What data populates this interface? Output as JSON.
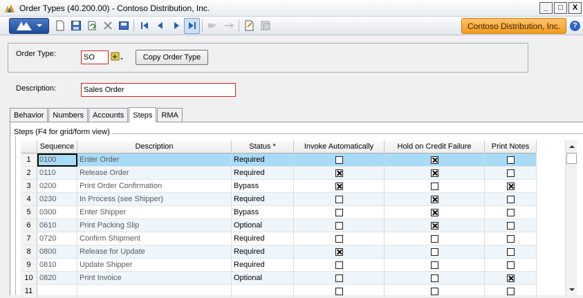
{
  "window": {
    "title": "Order Types (40.200.00) - Contoso Distribution, Inc.",
    "minimize": "_",
    "maximize": "□",
    "close": "X"
  },
  "toolbar": {
    "company": "Contoso Distribution, Inc.",
    "help": "?"
  },
  "form": {
    "order_type_label": "Order Type:",
    "order_type_value": "SO",
    "copy_button": "Copy Order Type",
    "description_label": "Description:",
    "description_value": "Sales Order"
  },
  "tabs": [
    {
      "label": "Behavior"
    },
    {
      "label": "Numbers"
    },
    {
      "label": "Accounts"
    },
    {
      "label": "Steps"
    },
    {
      "label": "RMA"
    }
  ],
  "active_tab": "Steps",
  "steps": {
    "group_label": "Steps (F4 for grid/form view)",
    "columns": [
      "",
      "Sequence",
      "Description",
      "Status *",
      "Invoke Automatically",
      "Hold on Credit Failure",
      "Print Notes"
    ],
    "rows": [
      {
        "num": "1",
        "sequence": "0100",
        "description": "Enter Order",
        "status": "Required",
        "invoke": false,
        "hold": true,
        "print": false
      },
      {
        "num": "2",
        "sequence": "0110",
        "description": "Release Order",
        "status": "Required",
        "invoke": true,
        "hold": true,
        "print": false
      },
      {
        "num": "3",
        "sequence": "0200",
        "description": "Print Order Confirmation",
        "status": "Bypass",
        "invoke": true,
        "hold": false,
        "print": true
      },
      {
        "num": "4",
        "sequence": "0230",
        "description": "In Process (see Shipper)",
        "status": "Required",
        "invoke": false,
        "hold": true,
        "print": false
      },
      {
        "num": "5",
        "sequence": "0300",
        "description": "Enter Shipper",
        "status": "Bypass",
        "invoke": false,
        "hold": true,
        "print": false
      },
      {
        "num": "6",
        "sequence": "0610",
        "description": "Print Packing Slip",
        "status": "Optional",
        "invoke": false,
        "hold": true,
        "print": false
      },
      {
        "num": "7",
        "sequence": "0720",
        "description": "Confirm Shipment",
        "status": "Required",
        "invoke": false,
        "hold": false,
        "print": false
      },
      {
        "num": "8",
        "sequence": "0800",
        "description": "Release for Update",
        "status": "Required",
        "invoke": true,
        "hold": false,
        "print": false
      },
      {
        "num": "9",
        "sequence": "0810",
        "description": "Update Shipper",
        "status": "Required",
        "invoke": false,
        "hold": false,
        "print": false
      },
      {
        "num": "10",
        "sequence": "0820",
        "description": "Print Invoice",
        "status": "Optional",
        "invoke": false,
        "hold": false,
        "print": true
      },
      {
        "num": "11",
        "sequence": "",
        "description": "",
        "status": "",
        "invoke": false,
        "hold": false,
        "print": false
      }
    ]
  },
  "colors": {
    "selected_row": "#a9daf6",
    "required_field_border": "#d11f1f",
    "company_badge": "#f29a1e"
  }
}
